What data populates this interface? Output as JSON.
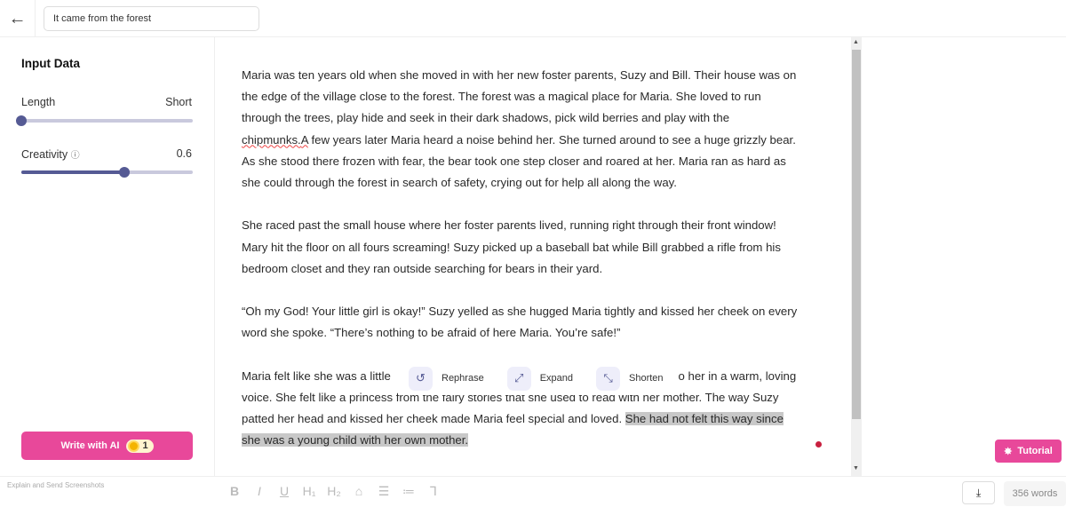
{
  "header": {
    "back_icon": "arrow-left-icon",
    "title_value": "It came from the forest"
  },
  "sidebar": {
    "title": "Input Data",
    "length": {
      "label": "Length",
      "value": "Short",
      "level": 0
    },
    "creativity": {
      "label": "Creativity",
      "info_icon": "info-icon",
      "value": "0.6",
      "level": 0.6
    },
    "write_button": {
      "label": "Write with AI",
      "credits": "1"
    }
  },
  "editor": {
    "paragraphs": [
      [
        "Maria was ten years old when she moved in with her new foster parents, Suzy and Bill. Their house was on",
        "the edge of the village close to the forest. The forest was a magical place for Maria. She loved to run",
        "through the trees, play hide and seek in their dark shadows, pick wild berries and play with the"
      ],
      [
        "She raced past the small house where her foster parents lived, running right through their front window!",
        "Mary hit the floor on all fours screaming! Suzy picked up a baseball bat while Bill grabbed a rifle from his",
        "bedroom closet and they ran outside searching for bears in their yard."
      ],
      [
        "“Oh my God! Your little girl is okay!” Suzy yelled as she hugged Maria tightly and kissed her cheek on every",
        "word she spoke. “There’s nothing to be afraid of here Maria. You’re safe!”"
      ]
    ],
    "p1_line4_a": "chipmunks.",
    "p1_line4_b": "A",
    "p1_line4_c": " few years later Maria heard a noise behind her. She turned around to see a huge grizzly bear.",
    "p1_line5": "As she stood there frozen with fear, the bear took one step closer and roared at her. Maria ran as hard as",
    "p1_line6": "she could through the forest in search of safety, crying out for help all along the way.",
    "p4_line1_a": "Maria felt like she was a little",
    "p4_line1_b": "to her in a warm, loving",
    "p4_line2": "voice. She felt like a princess from the fairy stories that she used to read with her mother. The way Suzy",
    "p4_line3": "patted her head and kissed her cheek made Maria feel special and loved. ",
    "p4_line3_sel": "She had not felt this way since",
    "p4_line4_sel": "she was a young child with her own mother."
  },
  "popup": {
    "rephrase": "Rephrase",
    "expand": "Expand",
    "shorten": "Shorten"
  },
  "tutorial": "Tutorial",
  "bottom": {
    "overlay": "Explain and Send Screenshots",
    "word_count": "356 words",
    "download_icon": "download-icon"
  },
  "colors": {
    "accent": "#e8489a",
    "slider": "#555a94"
  }
}
